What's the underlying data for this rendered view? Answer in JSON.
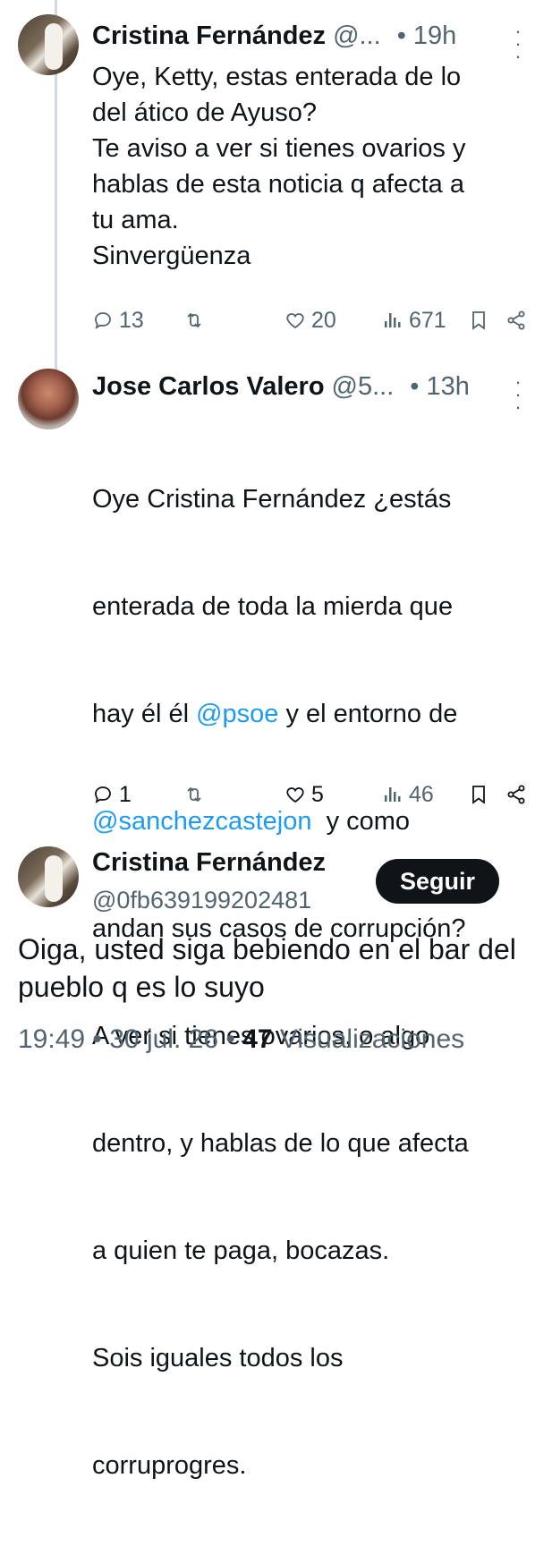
{
  "replies": [
    {
      "name": "Cristina Fernández",
      "handle": "@...",
      "time": "• 19h",
      "text_lines": [
        "Oye, Ketty, estas enterada de lo",
        "del ático de Ayuso?",
        "Te aviso a ver si tienes ovarios y",
        "hablas de esta noticia q afecta a",
        "tu ama.",
        "Sinvergüenza"
      ],
      "replies_count": "13",
      "likes": "20",
      "views": "671"
    },
    {
      "name": "Jose Carlos Valero",
      "handle": "@5...",
      "time": "• 13h",
      "line1": "Oye Cristina Fernández ¿estás",
      "line2": "enterada de toda la mierda que",
      "line3_pre": "hay él él ",
      "mention1": "@psoe",
      "line3_post": " y el entorno de",
      "mention2": "@sanchezcastejon",
      "line4_post": "  y como",
      "rest_lines": [
        "andan sus casos de corrupción?",
        "A ver si tienes ovarios, o algo",
        "dentro, y hablas de lo que afecta",
        "a quien te paga, bocazas.",
        "Sois iguales todos los",
        "corruprogres."
      ],
      "replies_count": "1",
      "likes": "5",
      "views": "46"
    }
  ],
  "main_tweet": {
    "name": "Cristina Fernández",
    "handle": "@0fb639199202481",
    "follow_label": "Seguir",
    "text": "Oiga, usted siga bebiendo  en el bar del pueblo q es lo suyo",
    "time": "19:49 • 30 jul. 26 •",
    "views_count": "47",
    "views_label": "Visualizaciones"
  },
  "icons": [
    "reply-icon",
    "retweet-icon",
    "like-icon",
    "views-icon",
    "bookmark-icon",
    "share-icon",
    "more-icon"
  ],
  "colors": {
    "text": "#0f1419",
    "secondary": "#536471",
    "link": "#1d9bf0",
    "button": "#0f1419"
  }
}
